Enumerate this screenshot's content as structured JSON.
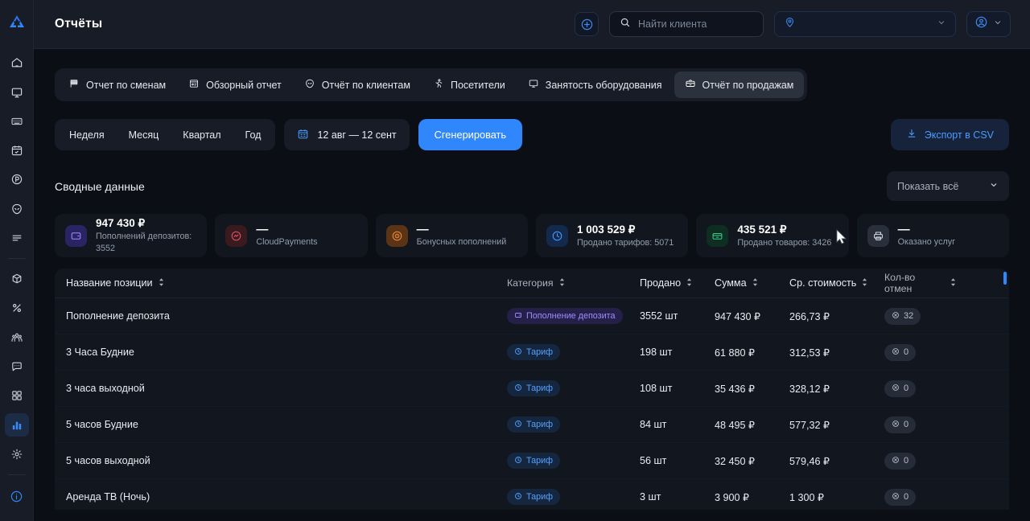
{
  "header": {
    "title": "Отчёты",
    "add_button_icon": "plus-circle-icon",
    "search": {
      "placeholder": "Найти клиента",
      "value": "",
      "icon": "search-icon"
    },
    "location": {
      "value": "",
      "icon": "map-pin-icon",
      "chevron": "chevron-down-icon"
    },
    "user": {
      "icon": "user-circle-icon",
      "chevron": "chevron-down-icon"
    }
  },
  "sidebar": {
    "logo": "app-logo",
    "items": [
      {
        "icon": "home-icon",
        "active": false
      },
      {
        "icon": "monitor-icon",
        "active": false
      },
      {
        "icon": "keyboard-icon",
        "active": false
      },
      {
        "icon": "calendar-check-icon",
        "active": false
      },
      {
        "icon": "parking-icon",
        "active": false
      },
      {
        "icon": "alien-icon",
        "active": false
      },
      {
        "icon": "list-icon",
        "active": false
      },
      {
        "icon": "box-plus-icon",
        "active": false
      },
      {
        "icon": "percent-icon",
        "active": false
      },
      {
        "icon": "users-group-icon",
        "active": false
      },
      {
        "icon": "chat-icon",
        "active": false
      },
      {
        "icon": "grid-apps-icon",
        "active": false
      },
      {
        "icon": "bar-chart-icon",
        "active": true
      },
      {
        "icon": "gear-icon",
        "active": false
      }
    ],
    "bottom": {
      "icon": "info-circle-icon"
    }
  },
  "tabs": [
    {
      "label": "Отчет по сменам",
      "icon": "flag-icon",
      "active": false
    },
    {
      "label": "Обзорный отчет",
      "icon": "report-card-icon",
      "active": false
    },
    {
      "label": "Отчёт по клиентам",
      "icon": "alien-icon",
      "active": false
    },
    {
      "label": "Посетители",
      "icon": "running-person-icon",
      "active": false
    },
    {
      "label": "Занятость оборудования",
      "icon": "monitor-icon",
      "active": false
    },
    {
      "label": "Отчёт по продажам",
      "icon": "cashbox-icon",
      "active": true
    }
  ],
  "filters": {
    "periods": [
      {
        "label": "Неделя",
        "active": false
      },
      {
        "label": "Месяц",
        "active": false
      },
      {
        "label": "Квартал",
        "active": false
      },
      {
        "label": "Год",
        "active": false
      }
    ],
    "date_range": {
      "label": "12 авг — 12 сент",
      "icon": "calendar-icon"
    },
    "generate_label": "Сгенерировать",
    "export_label": "Экспорт в CSV",
    "export_icon": "download-icon"
  },
  "summary": {
    "title": "Сводные данные",
    "show_all": {
      "label": "Показать всё",
      "chevron": "chevron-down-icon"
    },
    "cards": [
      {
        "value": "947 430 ₽",
        "sub": "Пополнений депозитов: 3552",
        "icon": "wallet-icon",
        "icon_bg": "#2b2464",
        "icon_color": "#9e8dfb"
      },
      {
        "value": "—",
        "sub": "CloudPayments",
        "icon": "cloudpayments-icon",
        "icon_bg": "#3a1a1f",
        "icon_color": "#e05666"
      },
      {
        "value": "—",
        "sub": "Бонусных пополнений",
        "icon": "bonus-target-icon",
        "icon_bg": "#5a3415",
        "icon_color": "#f08c3a"
      },
      {
        "value": "1 003 529 ₽",
        "sub": "Продано тарифов: 5071",
        "icon": "clock-icon",
        "icon_bg": "#132a4d",
        "icon_color": "#4b9bff"
      },
      {
        "value": "435 521 ₽",
        "sub": "Продано товаров: 3426",
        "icon": "shop-icon",
        "icon_bg": "#0f2e22",
        "icon_color": "#3ec98b"
      },
      {
        "value": "—",
        "sub": "Оказано услуг",
        "icon": "printer-icon",
        "icon_bg": "#2a303b",
        "icon_color": "#d4dae3"
      }
    ]
  },
  "table": {
    "columns": [
      {
        "label": "Название позиции",
        "sortable": true
      },
      {
        "label": "Категория",
        "sortable": true
      },
      {
        "label": "Продано",
        "sortable": true
      },
      {
        "label": "Сумма",
        "sortable": true
      },
      {
        "label": "Ср. стоимость",
        "sortable": true
      },
      {
        "label": "Кол-во отмен",
        "sortable": true
      }
    ],
    "rows": [
      {
        "name": "Пополнение депозита",
        "category": "Пополнение депозита",
        "category_type": "deposit",
        "category_icon": "wallet-icon",
        "sold": "3552 шт",
        "sum": "947 430 ₽",
        "avg": "266,73 ₽",
        "cancels": "32"
      },
      {
        "name": "3 Часа Будние",
        "category": "Тариф",
        "category_type": "tariff",
        "category_icon": "clock-icon",
        "sold": "198 шт",
        "sum": "61 880 ₽",
        "avg": "312,53 ₽",
        "cancels": "0"
      },
      {
        "name": "3 часа выходной",
        "category": "Тариф",
        "category_type": "tariff",
        "category_icon": "clock-icon",
        "sold": "108 шт",
        "sum": "35 436 ₽",
        "avg": "328,12 ₽",
        "cancels": "0"
      },
      {
        "name": "5 часов Будние",
        "category": "Тариф",
        "category_type": "tariff",
        "category_icon": "clock-icon",
        "sold": "84 шт",
        "sum": "48 495 ₽",
        "avg": "577,32 ₽",
        "cancels": "0"
      },
      {
        "name": "5 часов выходной",
        "category": "Тариф",
        "category_type": "tariff",
        "category_icon": "clock-icon",
        "sold": "56 шт",
        "sum": "32 450 ₽",
        "avg": "579,46 ₽",
        "cancels": "0"
      },
      {
        "name": "Аренда ТВ (Ночь)",
        "category": "Тариф",
        "category_type": "tariff",
        "category_icon": "clock-icon",
        "sold": "3 шт",
        "sum": "3 900 ₽",
        "avg": "1 300 ₽",
        "cancels": "0"
      }
    ]
  },
  "colors": {
    "accent": "#2f87fb",
    "background": "#0b0e14",
    "panel": "#171c26",
    "card": "#11161f",
    "text": "#e8ecf2",
    "muted": "#939eae"
  }
}
